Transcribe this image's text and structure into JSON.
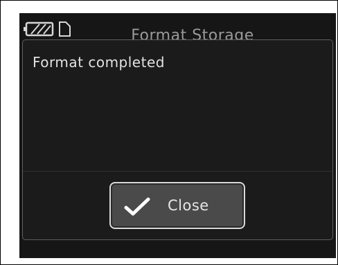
{
  "status_bar": {
    "battery_icon": "battery-icon",
    "storage_icon": "sd-card-icon"
  },
  "screen": {
    "title": "Format Storage"
  },
  "dialog": {
    "message": "Format completed",
    "close_button": {
      "label": "Close",
      "icon": "checkmark-icon"
    }
  },
  "colors": {
    "screen_background": "#161616",
    "button_border": "#d9d9d9",
    "button_fill": "#4a4a4a",
    "text": "#e2e2e2"
  }
}
